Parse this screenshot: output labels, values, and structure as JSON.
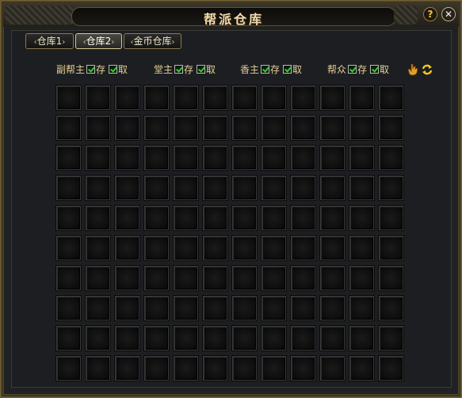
{
  "window": {
    "title": "帮派仓库",
    "help_label": "?",
    "close_label": "✕"
  },
  "tabs": [
    {
      "label": "仓库1",
      "active": false
    },
    {
      "label": "仓库2",
      "active": true
    },
    {
      "label": "金币仓库",
      "active": false
    }
  ],
  "permissions": [
    {
      "role": "副帮主",
      "deposit_label": "存",
      "deposit_checked": true,
      "withdraw_label": "取",
      "withdraw_checked": true
    },
    {
      "role": "堂主",
      "deposit_label": "存",
      "deposit_checked": true,
      "withdraw_label": "取",
      "withdraw_checked": true
    },
    {
      "role": "香主",
      "deposit_label": "存",
      "deposit_checked": true,
      "withdraw_label": "取",
      "withdraw_checked": true
    },
    {
      "role": "帮众",
      "deposit_label": "存",
      "deposit_checked": true,
      "withdraw_label": "取",
      "withdraw_checked": true
    }
  ],
  "toolbar_icons": [
    "hand-icon",
    "refresh-icon"
  ],
  "grid": {
    "columns": 12,
    "rows": 10,
    "occupied_slots": 0
  },
  "colors": {
    "accent_gold": "#e8cf96",
    "check_green": "#2fd12f",
    "frame": "#6b5a32"
  }
}
